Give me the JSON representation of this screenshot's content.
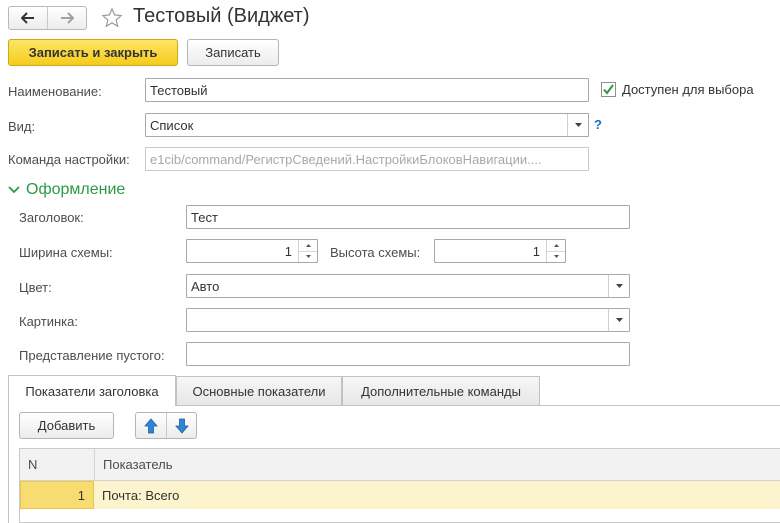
{
  "window": {
    "title": "Тестовый (Виджет)"
  },
  "toolbar": {
    "save_close_label": "Записать и закрыть",
    "save_label": "Записать"
  },
  "form": {
    "name_label": "Наименование:",
    "name_value": "Тестовый",
    "available_label": "Доступен для выбора",
    "available_checked": true,
    "view_label": "Вид:",
    "view_value": "Список",
    "help_label": "?",
    "command_label": "Команда настройки:",
    "command_value": "e1cib/command/РегистрСведений.НастройкиБлоковНавигации...."
  },
  "design": {
    "section_title": "Оформление",
    "header_label": "Заголовок:",
    "header_value": "Тест",
    "width_label": "Ширина схемы:",
    "width_value": "1",
    "height_label": "Высота схемы:",
    "height_value": "1",
    "color_label": "Цвет:",
    "color_value": "Авто",
    "picture_label": "Картинка:",
    "picture_value": "",
    "empty_label": "Представление пустого:",
    "empty_value": ""
  },
  "tabs": [
    {
      "label": "Показатели заголовка",
      "active": true
    },
    {
      "label": "Основные показатели",
      "active": false
    },
    {
      "label": "Дополнительные команды",
      "active": false
    }
  ],
  "tab_toolbar": {
    "add_label": "Добавить"
  },
  "table": {
    "columns": [
      "N",
      "Показатель"
    ],
    "rows": [
      {
        "n": "1",
        "indicator": "Почта: Всего"
      }
    ]
  },
  "colors": {
    "accent_green": "#2a9a45",
    "primary_button": "#f5cc1b",
    "selected_row": "#fbf4cd",
    "help_blue": "#1a6fc9",
    "arrow_blue": "#2f86d6"
  },
  "icons": {
    "back": "arrow-left-icon",
    "forward": "arrow-right-icon",
    "favorite": "star-icon",
    "checkbox": "checkmark-icon",
    "dropdown": "chevron-down-icon",
    "collapse": "chevron-down-icon",
    "move_up": "arrow-up-icon",
    "move_down": "arrow-down-icon"
  }
}
